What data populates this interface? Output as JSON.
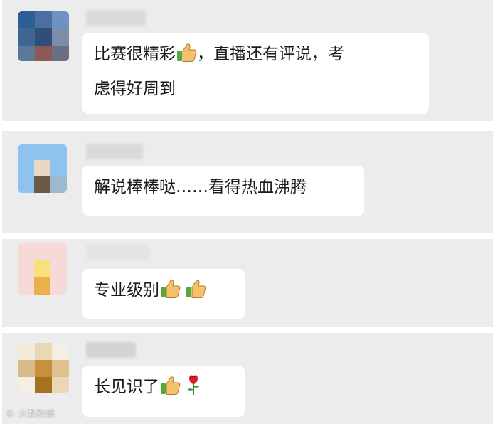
{
  "comments": [
    {
      "line1_a": "比赛很精彩",
      "line1_b": "，直播还有评说，考",
      "line2": "虑得好周到"
    },
    {
      "text": "解说棒棒哒……看得热血沸腾"
    },
    {
      "text": "专业级别"
    },
    {
      "text": "长见识了"
    }
  ],
  "icons": {
    "thumbs_up": "thumbs-up-icon",
    "rose": "rose-icon"
  },
  "watermark": "大数跨境",
  "colors": {
    "background": "#ececec",
    "bubble": "#ffffff",
    "text": "#1a1a1a"
  }
}
